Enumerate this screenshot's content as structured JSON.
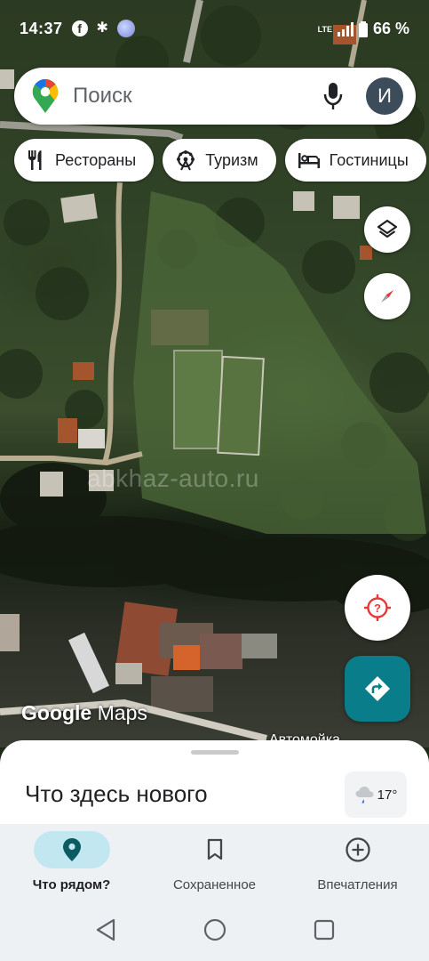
{
  "status_bar": {
    "time": "14:37",
    "battery": "66 %",
    "network": "LTE",
    "icons": [
      "facebook-icon",
      "bluetooth-icon",
      "avatar-icon"
    ]
  },
  "search": {
    "placeholder": "Поиск",
    "account_initial": "И"
  },
  "chips": [
    {
      "label": "Рестораны",
      "icon": "fork-knife-icon"
    },
    {
      "label": "Туризм",
      "icon": "attraction-icon"
    },
    {
      "label": "Гостиницы",
      "icon": "bed-icon"
    }
  ],
  "map": {
    "watermark": "abkhaz-auto.ru",
    "logo_bold": "Google",
    "logo_light": "Maps",
    "place_label": "Автомойка"
  },
  "sheet": {
    "title": "Что здесь нового",
    "temperature": "17°",
    "weather_icon": "cloud-rain-icon"
  },
  "bottom_nav": [
    {
      "label": "Что рядом?",
      "icon": "location-pin-icon",
      "active": true
    },
    {
      "label": "Сохраненное",
      "icon": "bookmark-icon",
      "active": false
    },
    {
      "label": "Впечатления",
      "icon": "add-circle-icon",
      "active": false
    }
  ],
  "colors": {
    "accent_teal": "#0a7d8a",
    "active_nav_bg": "#c2e7f0",
    "location_red": "#e53935"
  }
}
